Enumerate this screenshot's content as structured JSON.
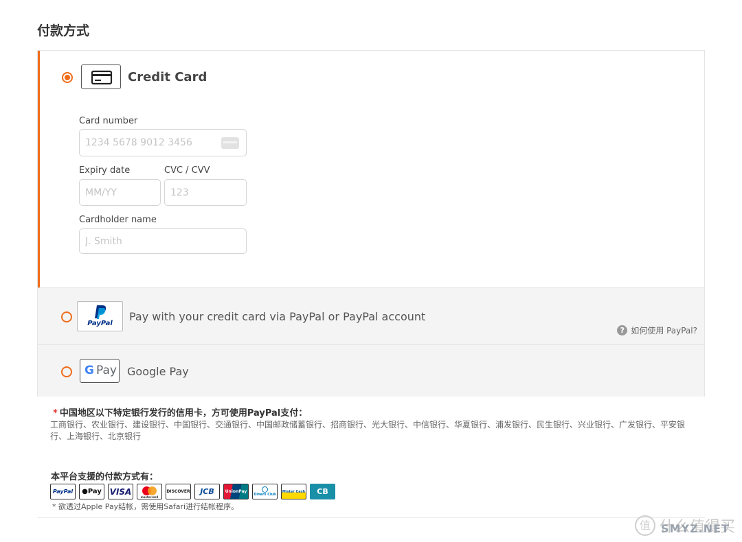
{
  "page": {
    "title": "付款方式"
  },
  "methods": {
    "credit_card": {
      "label": "Credit Card",
      "selected": true,
      "card_number_label": "Card number",
      "card_number_placeholder": "1234 5678 9012 3456",
      "expiry_label": "Expiry date",
      "expiry_placeholder": "MM/YY",
      "cvc_label": "CVC / CVV",
      "cvc_placeholder": "123",
      "holder_label": "Cardholder name",
      "holder_placeholder": "J. Smith"
    },
    "paypal": {
      "label": "Pay with your credit card via PayPal or PayPal account",
      "logo_text": "PayPal",
      "help_text": "如何使用 PayPal?",
      "selected": false
    },
    "google_pay": {
      "label": "Google Pay",
      "logo_g": "G",
      "logo_pay": "Pay",
      "selected": false
    }
  },
  "notes": {
    "star": "*",
    "title": "中国地区以下特定银行发行的信用卡，方可使用PayPal支付：",
    "banks": "工商银行、农业银行、建设银行、中国银行、交通银行、中国邮政储蓄银行、招商银行、光大银行、中信银行、华夏银行、浦发银行、民生银行、兴业银行、广发银行、平安银行、上海银行、北京银行"
  },
  "supported": {
    "title": "本平台支援的付款方式有：",
    "brands": [
      "PayPal",
      "Pay",
      "VISA",
      "mastercard",
      "DISCOVER",
      "JCB",
      "UnionPay",
      "Diners Club",
      "Mister Cash",
      "CB"
    ],
    "apple_note": "* 欲透过Apple Pay结帐，需使用Safari进行结帐程序。"
  },
  "watermark": {
    "text": "什么值得买",
    "site": "SMYZ.NET"
  },
  "colors": {
    "accent": "#ef6c1a",
    "paypal_dark": "#003087",
    "paypal_light": "#009cde",
    "visa_blue": "#1a1f71"
  }
}
